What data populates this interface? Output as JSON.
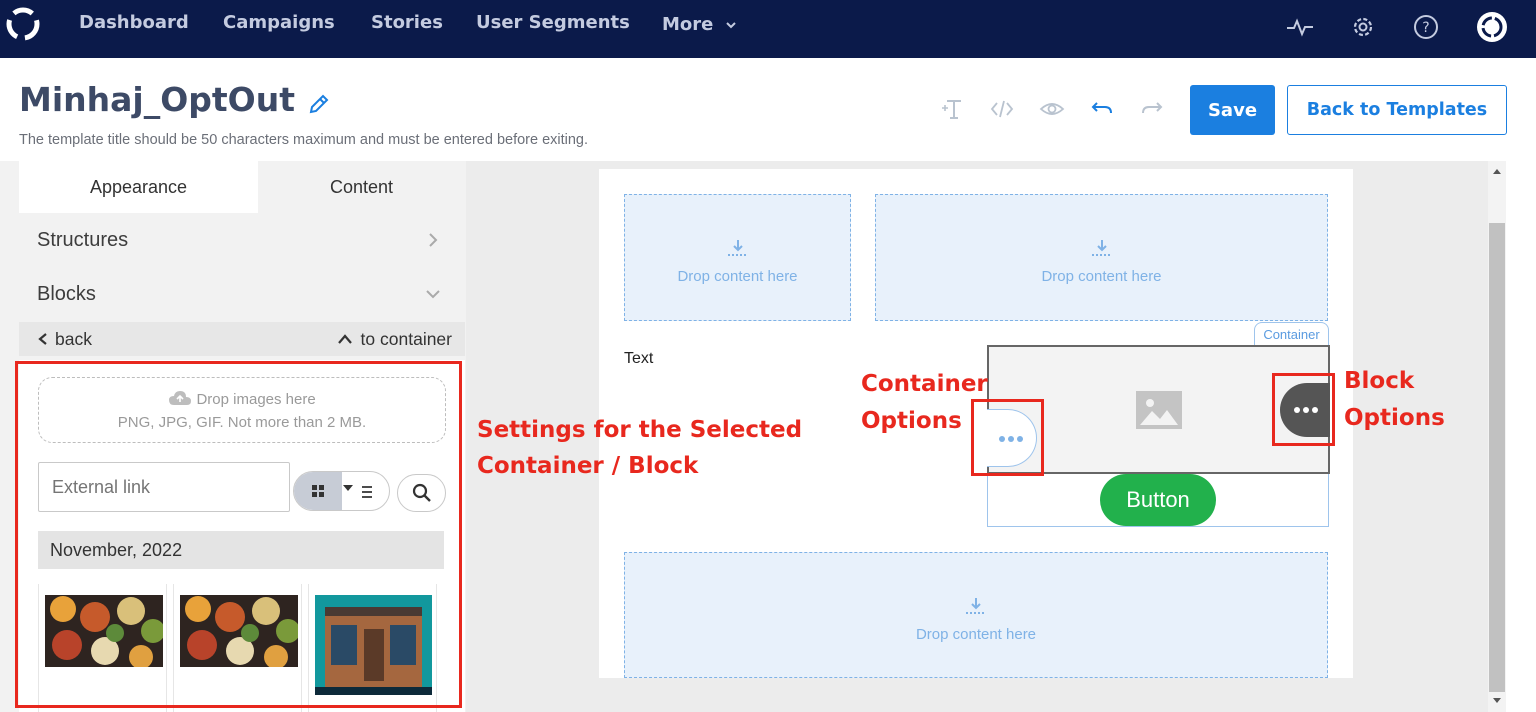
{
  "nav": {
    "items": [
      "Dashboard",
      "Campaigns",
      "Stories",
      "User Segments",
      "More"
    ],
    "icons": [
      "activity-icon",
      "gear-icon",
      "help-icon",
      "profile-icon"
    ],
    "bg_color": "#0b1a4a"
  },
  "header": {
    "title": "Minhaj_OptOut",
    "hint": "The template title should be 50 characters maximum and must be entered before exiting.",
    "save_label": "Save",
    "back_label": "Back to Templates",
    "accent": "#1b7fe0"
  },
  "left_panel": {
    "tabs": [
      "Appearance",
      "Content"
    ],
    "sections": [
      "Structures",
      "Blocks"
    ],
    "back_label": "back",
    "to_container_label": "to container",
    "drop_images": {
      "title": "Drop images here",
      "subtitle": "PNG, JPG, GIF. Not more than 2 MB."
    },
    "external_link_placeholder": "External link",
    "date_group": "November, 2022"
  },
  "canvas": {
    "drop_text": "Drop content here",
    "text_block": "Text",
    "container_tag": "Container",
    "button_label": "Button",
    "button_color": "#22b14c"
  },
  "annotations": {
    "settings_line1": "Settings for the Selected",
    "settings_line2": "Container / Block",
    "container_line1": "Container",
    "container_line2": "Options",
    "block_line1": "Block",
    "block_line2": "Options",
    "color": "#e8281e"
  }
}
